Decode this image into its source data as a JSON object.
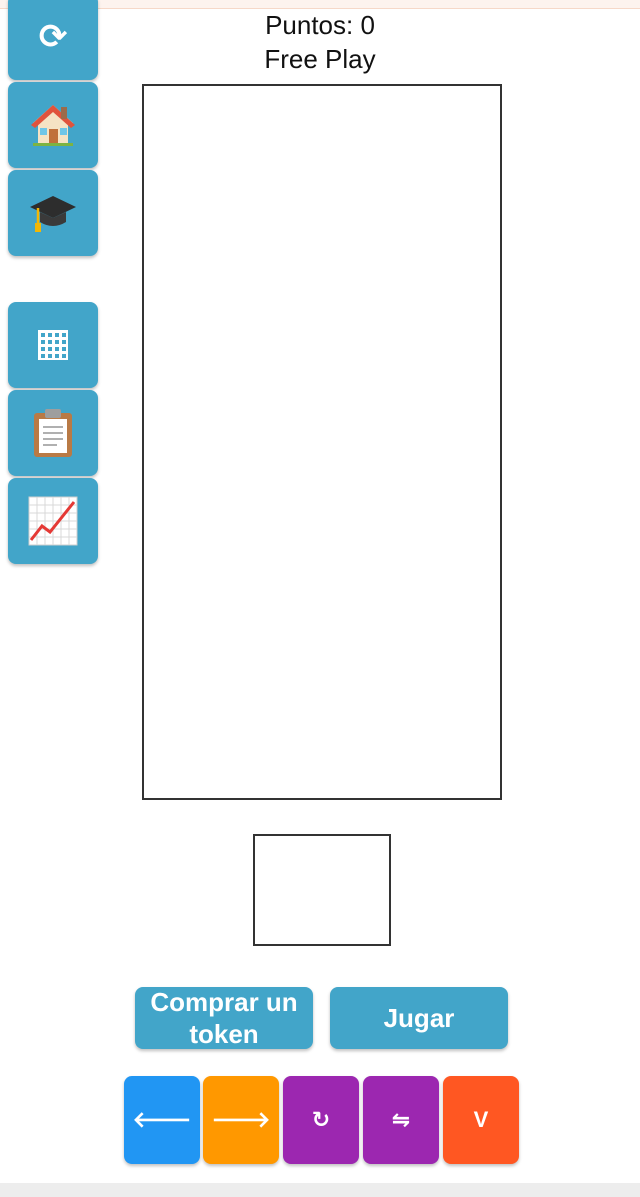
{
  "header": {
    "score_label": "Puntos: 0",
    "mode_label": "Free Play"
  },
  "sidebar": {
    "buttons": [
      {
        "name": "restart",
        "icon": "refresh-icon",
        "glyph": "⟳"
      },
      {
        "name": "home",
        "icon": "house-icon"
      },
      {
        "name": "tutorial",
        "icon": "graduation-cap-icon"
      },
      {
        "name": "grid",
        "icon": "grid-icon"
      },
      {
        "name": "clipboard",
        "icon": "clipboard-icon"
      },
      {
        "name": "stats",
        "icon": "chart-increasing-icon"
      }
    ]
  },
  "actions": {
    "buy_token_label": "Comprar un token",
    "play_label": "Jugar"
  },
  "controls": [
    {
      "name": "move-left",
      "glyph": "🡐",
      "color": "#2196f3"
    },
    {
      "name": "move-right",
      "glyph": "🡒",
      "color": "#ff9800"
    },
    {
      "name": "rotate",
      "glyph": "↻",
      "color": "#9c27b0"
    },
    {
      "name": "flip",
      "glyph": "⇋",
      "color": "#9c27b0"
    },
    {
      "name": "drop",
      "glyph": "V",
      "color": "#ff5722"
    }
  ],
  "colors": {
    "sidebar_button": "#42a5c9",
    "action_button": "#42a5c9"
  }
}
